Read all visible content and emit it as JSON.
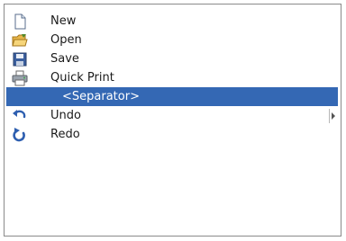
{
  "menu": {
    "items": [
      {
        "label": "New",
        "icon": "new-document-icon"
      },
      {
        "label": "Open",
        "icon": "open-folder-icon"
      },
      {
        "label": "Save",
        "icon": "save-disk-icon"
      },
      {
        "label": "Quick Print",
        "icon": "printer-icon"
      },
      {
        "label": "<Separator>",
        "icon": "",
        "selected": true
      },
      {
        "label": "Undo",
        "icon": "undo-icon",
        "has_submenu": true
      },
      {
        "label": "Redo",
        "icon": "redo-icon"
      }
    ]
  },
  "colors": {
    "selection": "#3468b4",
    "selected_text": "#ffffff",
    "border": "#8a8a8a"
  }
}
